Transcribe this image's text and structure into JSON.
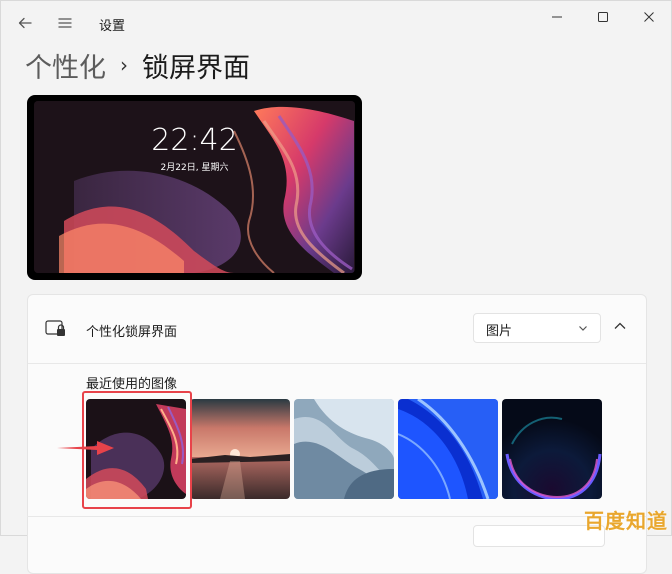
{
  "app": {
    "title": "设置"
  },
  "breadcrumb": {
    "parent": "个性化",
    "separator": "›",
    "current": "锁屏界面"
  },
  "preview": {
    "time": "22:42",
    "date": "2月22日, 星期六"
  },
  "lock_screen": {
    "label": "个性化锁屏界面",
    "mode_value": "图片",
    "recent_label": "最近使用的图像",
    "images": [
      {
        "name": "purple-ribbon",
        "selected": true
      },
      {
        "name": "sunset-lake"
      },
      {
        "name": "blue-grey-waves"
      },
      {
        "name": "blue-bloom"
      },
      {
        "name": "dark-glow"
      }
    ]
  },
  "watermark": {
    "text": "百度知道"
  },
  "colors": {
    "highlight": "#e8434a",
    "watermark": "#e9a72e",
    "background": "#f3f3f3"
  }
}
